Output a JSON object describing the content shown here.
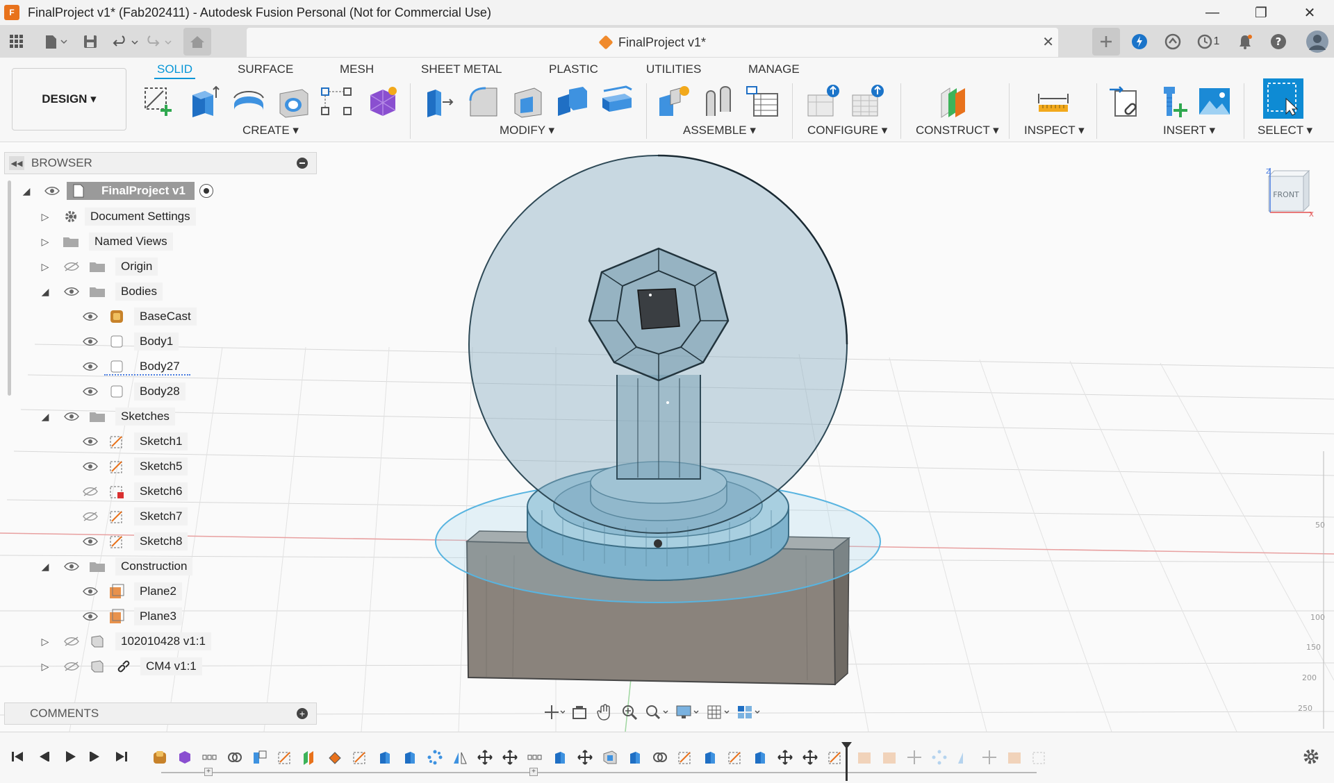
{
  "window": {
    "title": "FinalProject v1* (Fab202411) - Autodesk Fusion Personal (Not for Commercial Use)",
    "app_icon_letter": "F"
  },
  "document_tab": {
    "title": "FinalProject v1*"
  },
  "quick_access": {
    "jobs_count": "1"
  },
  "workspace": {
    "label": "DESIGN ▾"
  },
  "tabs": [
    "SOLID",
    "SURFACE",
    "MESH",
    "SHEET METAL",
    "PLASTIC",
    "UTILITIES",
    "MANAGE"
  ],
  "groups": {
    "create": "CREATE ▾",
    "modify": "MODIFY ▾",
    "assemble": "ASSEMBLE ▾",
    "configure": "CONFIGURE ▾",
    "construct": "CONSTRUCT ▾",
    "inspect": "INSPECT ▾",
    "insert": "INSERT ▾",
    "select": "SELECT ▾"
  },
  "browser": {
    "title": "BROWSER",
    "rows": [
      {
        "label": "FinalProject v1"
      },
      {
        "label": "Document Settings"
      },
      {
        "label": "Named Views"
      },
      {
        "label": "Origin"
      },
      {
        "label": "Bodies"
      },
      {
        "label": "BaseCast"
      },
      {
        "label": "Body1"
      },
      {
        "label": "Body27"
      },
      {
        "label": "Body28"
      },
      {
        "label": "Sketches"
      },
      {
        "label": "Sketch1"
      },
      {
        "label": "Sketch5"
      },
      {
        "label": "Sketch6"
      },
      {
        "label": "Sketch7"
      },
      {
        "label": "Sketch8"
      },
      {
        "label": "Construction"
      },
      {
        "label": "Plane2"
      },
      {
        "label": "Plane3"
      },
      {
        "label": "102010428 v1:1"
      },
      {
        "label": "CM4 v1:1"
      }
    ]
  },
  "comments": {
    "title": "COMMENTS"
  },
  "viewcube": {
    "face": "FRONT",
    "axis_z": "Z",
    "axis_x": "X"
  },
  "ruler_labels": [
    "50",
    "100",
    "150",
    "200",
    "250"
  ],
  "colors": {
    "accent": "#0696d7",
    "select": "#1a9ad6",
    "orange": "#e8721c"
  }
}
